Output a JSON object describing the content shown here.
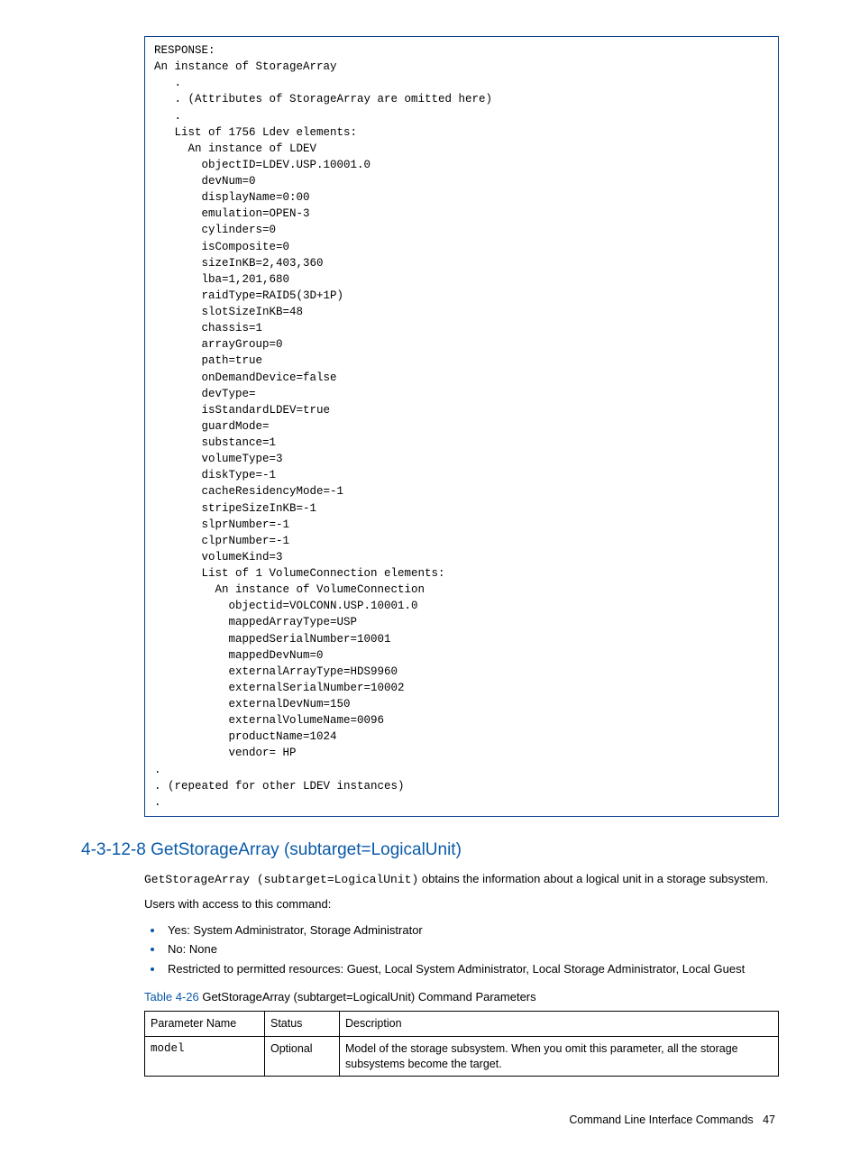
{
  "code": {
    "lines": [
      "RESPONSE:",
      "An instance of StorageArray",
      "   .",
      "   . (Attributes of StorageArray are omitted here)",
      "   .",
      "   List of 1756 Ldev elements:",
      "     An instance of LDEV",
      "       objectID=LDEV.USP.10001.0",
      "       devNum=0",
      "       displayName=0:00",
      "       emulation=OPEN-3",
      "       cylinders=0",
      "       isComposite=0",
      "       sizeInKB=2,403,360",
      "       lba=1,201,680",
      "       raidType=RAID5(3D+1P)",
      "       slotSizeInKB=48",
      "       chassis=1",
      "       arrayGroup=0",
      "       path=true",
      "       onDemandDevice=false",
      "       devType=",
      "       isStandardLDEV=true",
      "       guardMode=",
      "       substance=1",
      "       volumeType=3",
      "       diskType=-1",
      "       cacheResidencyMode=-1",
      "       stripeSizeInKB=-1",
      "       slprNumber=-1",
      "       clprNumber=-1",
      "       volumeKind=3",
      "       List of 1 VolumeConnection elements:",
      "         An instance of VolumeConnection",
      "           objectid=VOLCONN.USP.10001.0",
      "           mappedArrayType=USP",
      "           mappedSerialNumber=10001",
      "           mappedDevNum=0",
      "           externalArrayType=HDS9960",
      "           externalSerialNumber=10002",
      "           externalDevNum=150",
      "           externalVolumeName=0096",
      "           productName=1024",
      "           vendor= HP",
      ".",
      ". (repeated for other LDEV instances)",
      "."
    ]
  },
  "section": {
    "heading": "4-3-12-8 GetStorageArray (subtarget=LogicalUnit)",
    "intro_mono": "GetStorageArray (subtarget=LogicalUnit)",
    "intro_rest": " obtains the information about a logical unit in a storage subsystem.",
    "access_label": "Users with access to this command:",
    "bullets": [
      "Yes: System Administrator, Storage Administrator",
      "No: None",
      "Restricted to permitted resources: Guest, Local System Administrator, Local Storage Administrator, Local Guest"
    ],
    "table_caption_lead": "Table 4-26",
    "table_caption_rest": "  GetStorageArray (subtarget=LogicalUnit) Command Parameters",
    "table": {
      "headers": [
        "Parameter Name",
        "Status",
        "Description"
      ],
      "rows": [
        {
          "param": "model",
          "status": "Optional",
          "desc": "Model of the storage subsystem. When you omit this parameter, all the storage subsystems become the target."
        }
      ]
    }
  },
  "footer": {
    "label": "Command Line Interface Commands",
    "page": "47"
  }
}
